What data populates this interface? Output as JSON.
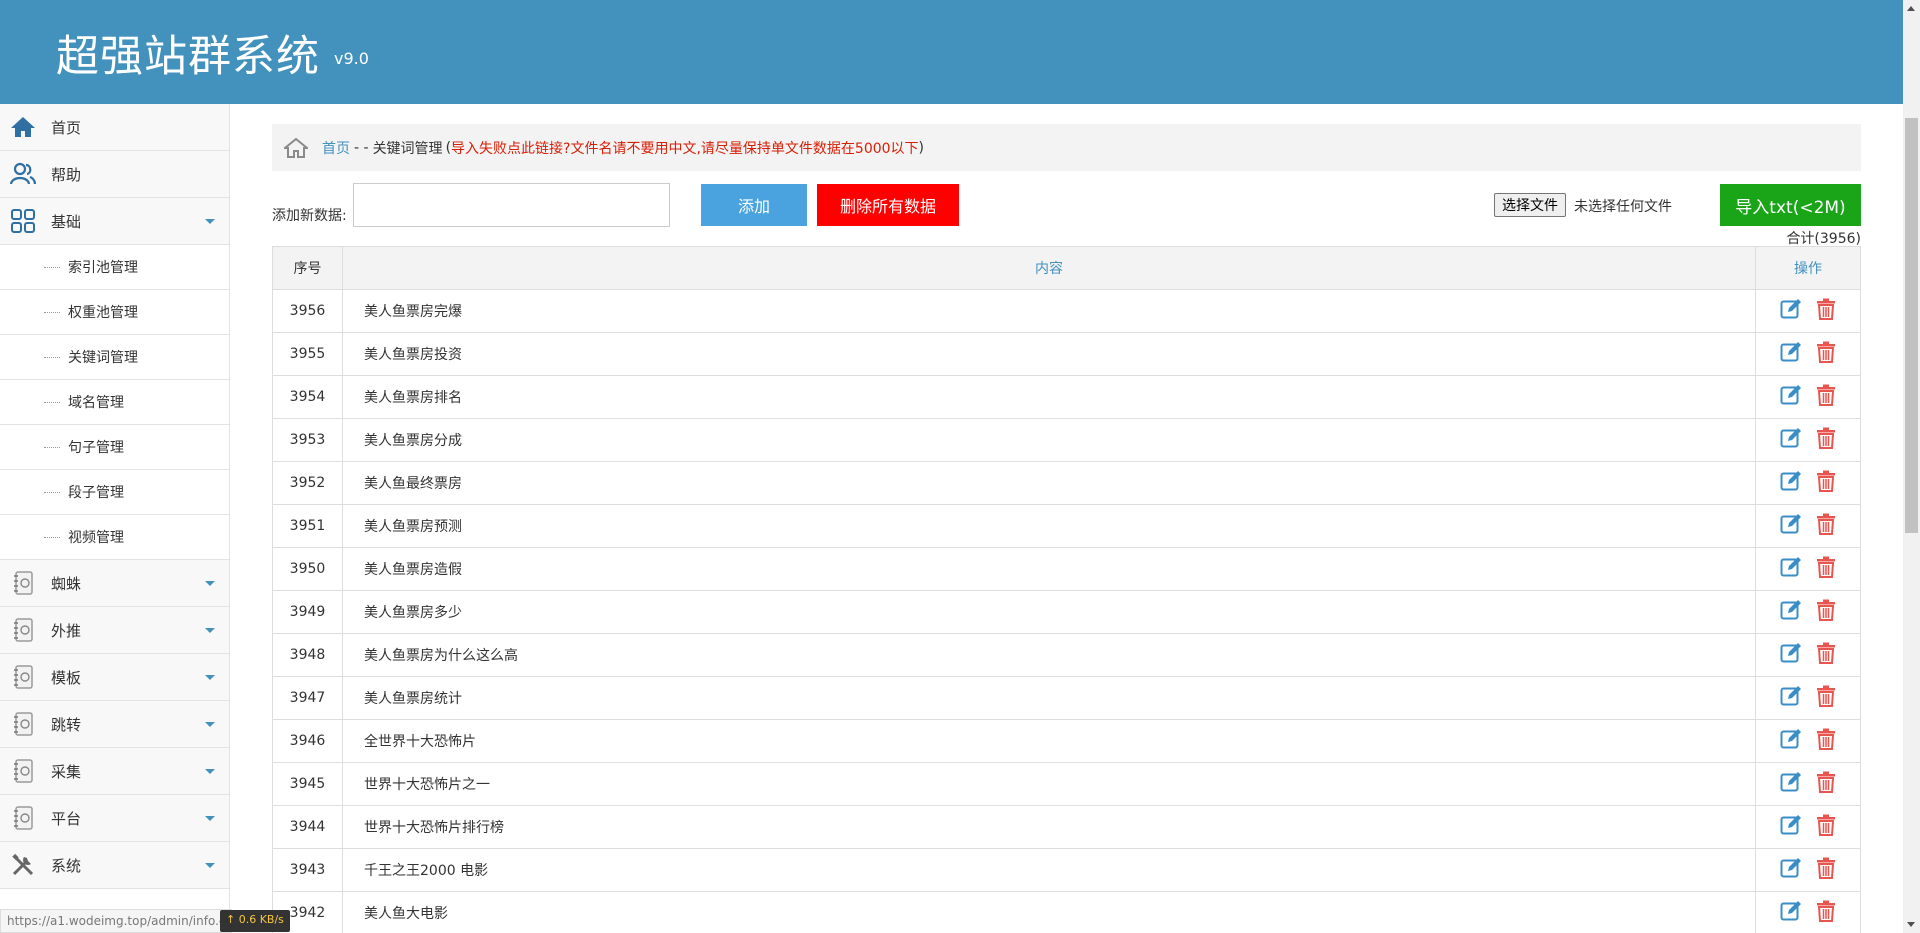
{
  "header": {
    "title": "超强站群系统",
    "version": "v9.0"
  },
  "sidebar": {
    "items": [
      {
        "label": "首页",
        "icon": "home-icon"
      },
      {
        "label": "帮助",
        "icon": "users-icon"
      },
      {
        "label": "基础",
        "icon": "grid-icon",
        "expanded": true,
        "children": [
          "索引池管理",
          "权重池管理",
          "关键词管理",
          "域名管理",
          "句子管理",
          "段子管理",
          "视频管理"
        ]
      },
      {
        "label": "蜘蛛",
        "icon": "notebook-icon"
      },
      {
        "label": "外推",
        "icon": "notebook-icon"
      },
      {
        "label": "模板",
        "icon": "notebook-icon"
      },
      {
        "label": "跳转",
        "icon": "notebook-icon"
      },
      {
        "label": "采集",
        "icon": "notebook-icon"
      },
      {
        "label": "平台",
        "icon": "notebook-icon"
      },
      {
        "label": "系统",
        "icon": "tools-icon"
      }
    ]
  },
  "breadcrumb": {
    "home": "首页",
    "separator": "- -",
    "current": "关键词管理",
    "open_paren": "(",
    "warning": "导入失败点此链接?文件名请不要用中文,请尽量保持单文件数据在5000以下",
    "close_paren": ")"
  },
  "toolbar": {
    "add_label": "添加新数据:",
    "add_value": "",
    "add_button": "添加",
    "delete_all_button": "删除所有数据",
    "choose_file_button": "选择文件",
    "file_status": "未选择任何文件",
    "import_button": "导入txt(<2M)",
    "total": "合计(3956)"
  },
  "table": {
    "headers": [
      "序号",
      "内容",
      "操作"
    ],
    "rows": [
      {
        "id": "3956",
        "content": "美人鱼票房完爆"
      },
      {
        "id": "3955",
        "content": "美人鱼票房投资"
      },
      {
        "id": "3954",
        "content": "美人鱼票房排名"
      },
      {
        "id": "3953",
        "content": "美人鱼票房分成"
      },
      {
        "id": "3952",
        "content": "美人鱼最终票房"
      },
      {
        "id": "3951",
        "content": "美人鱼票房预测"
      },
      {
        "id": "3950",
        "content": "美人鱼票房造假"
      },
      {
        "id": "3949",
        "content": "美人鱼票房多少"
      },
      {
        "id": "3948",
        "content": "美人鱼票房为什么这么高"
      },
      {
        "id": "3947",
        "content": "美人鱼票房统计"
      },
      {
        "id": "3946",
        "content": "全世界十大恐怖片"
      },
      {
        "id": "3945",
        "content": "世界十大恐怖片之一"
      },
      {
        "id": "3944",
        "content": "世界十大恐怖片排行榜"
      },
      {
        "id": "3943",
        "content": "千王之王2000 电影"
      },
      {
        "id": "3942",
        "content": "美人鱼大电影"
      }
    ]
  },
  "statusbar": {
    "url": "https://a1.wodeimg.top/admin/info.c",
    "net_speed": "↑ 0.6 KB/s"
  },
  "colors": {
    "header": "#4391bd",
    "add": "#4aa3df",
    "delete": "#ff0000",
    "import": "#1aa519",
    "edit_icon": "#3a8ec8",
    "trash_icon": "#e8554e"
  }
}
